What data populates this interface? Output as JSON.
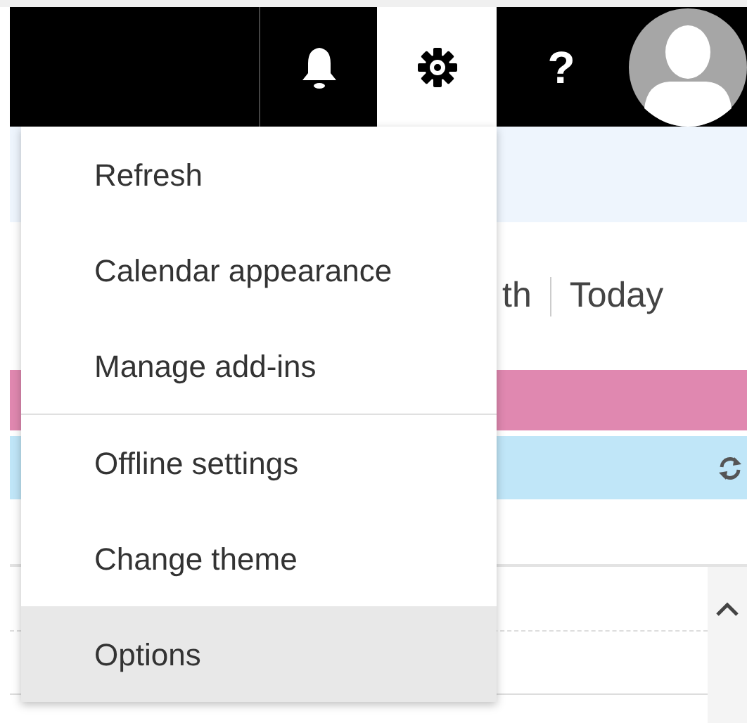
{
  "top_bar": {
    "buttons": [
      {
        "kind": "bell",
        "selected": false
      },
      {
        "kind": "gear",
        "selected": true
      },
      {
        "kind": "help",
        "label": "?",
        "selected": false
      }
    ]
  },
  "calendar_toolbar": {
    "view_label": "th",
    "today_label": "Today"
  },
  "settings_menu": {
    "items": [
      {
        "label": "Refresh",
        "selected": false,
        "divider_after": false
      },
      {
        "label": "Calendar appearance",
        "selected": false,
        "divider_after": false
      },
      {
        "label": "Manage add-ins",
        "selected": false,
        "divider_after": true
      },
      {
        "label": "Offline settings",
        "selected": false,
        "divider_after": false
      },
      {
        "label": "Change theme",
        "selected": false,
        "divider_after": false
      },
      {
        "label": "Options",
        "selected": true,
        "divider_after": false
      }
    ]
  }
}
